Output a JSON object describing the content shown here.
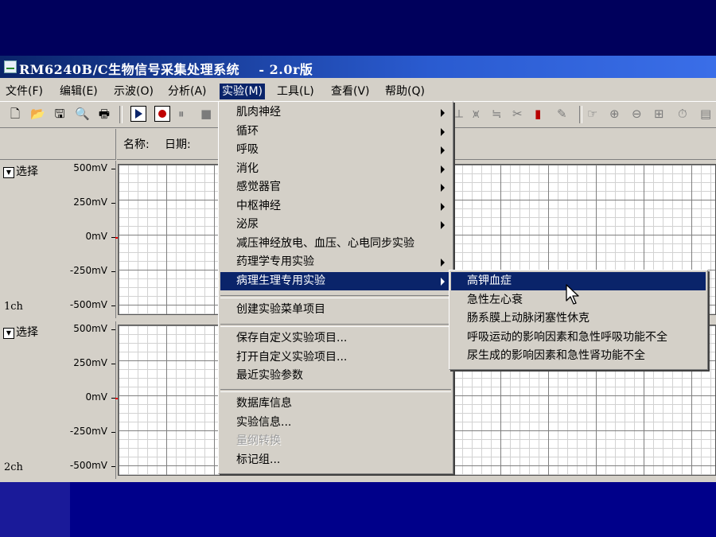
{
  "window": {
    "title": "RM6240B/C生物信号采集处理系统    - 2.0r版"
  },
  "menubar": [
    {
      "id": "file",
      "label": "文件(F)"
    },
    {
      "id": "edit",
      "label": "编辑(E)"
    },
    {
      "id": "scope",
      "label": "示波(O)"
    },
    {
      "id": "analysis",
      "label": "分析(A)"
    },
    {
      "id": "experiment",
      "label": "实验(M)"
    },
    {
      "id": "tools",
      "label": "工具(L)"
    },
    {
      "id": "view",
      "label": "查看(V)"
    },
    {
      "id": "help",
      "label": "帮助(Q)"
    }
  ],
  "infobar": {
    "name_label": "名称:",
    "date_label": "日期:"
  },
  "channels": [
    {
      "select_label": "选择",
      "name": "1ch",
      "scale": [
        "500mV",
        "250mV",
        "0mV",
        "-250mV",
        "-500mV"
      ]
    },
    {
      "select_label": "选择",
      "name": "2ch",
      "scale": [
        "500mV",
        "250mV",
        "0mV",
        "-250mV",
        "-500mV"
      ]
    }
  ],
  "experiment_menu": {
    "items": [
      "肌肉神经",
      "循环",
      "呼吸",
      "消化",
      "感觉器官",
      "中枢神经",
      "泌尿",
      "减压神经放电、血压、心电同步实验",
      "药理学专用实验",
      "病理生理专用实验",
      "创建实验菜单项目",
      "保存自定义实验项目...",
      "打开自定义实验项目...",
      "最近实验参数",
      "数据库信息",
      "实验信息...",
      "量纲转换",
      "标记组..."
    ]
  },
  "pathology_submenu": {
    "items": [
      "高钾血症",
      "急性左心衰",
      "肠系膜上动脉闭塞性休克",
      "呼吸运动的影响因素和急性呼吸功能不全",
      "尿生成的影响因素和急性肾功能不全"
    ]
  },
  "colors": {
    "highlight": "#0a246a",
    "slide_background": "#000066",
    "window_face": "#d4d0c8"
  }
}
